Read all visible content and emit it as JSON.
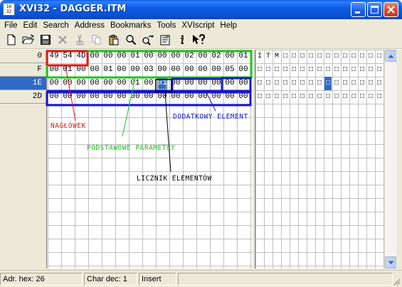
{
  "window": {
    "title": "XVI32 - DAGGER.ITM",
    "icon_text": "16 32",
    "buttons": [
      "minimize-icon",
      "maximize-icon",
      "close-icon"
    ]
  },
  "menu": [
    {
      "label": "File",
      "accel": "F"
    },
    {
      "label": "Edit",
      "accel": "E"
    },
    {
      "label": "Search",
      "accel": "S"
    },
    {
      "label": "Address",
      "accel": "A"
    },
    {
      "label": "Bookmarks",
      "accel": "B"
    },
    {
      "label": "Tools",
      "accel": "T"
    },
    {
      "label": "XVIscript",
      "accel": "X"
    },
    {
      "label": "Help",
      "accel": "H"
    }
  ],
  "toolbar": [
    "new-file-icon",
    "open-folder-icon",
    "save-disk-icon",
    "delete-x-icon",
    "cut-scissors-icon",
    "copy-icon",
    "paste-clipboard-icon",
    "find-magnifier-icon",
    "replace-icon",
    "properties-icon",
    "info-icon",
    "context-help-icon"
  ],
  "address_rows": [
    "0",
    "F",
    "1E",
    "2D"
  ],
  "selected_row": 2,
  "hex_rows": [
    [
      "49",
      "54",
      "4D",
      "00",
      "00",
      "00",
      "01",
      "00",
      "00",
      "00",
      "02",
      "00",
      "02",
      "00",
      "01"
    ],
    [
      "00",
      "01",
      "00",
      "00",
      "01",
      "00",
      "00",
      "03",
      "00",
      "00",
      "00",
      "00",
      "00",
      "05",
      "00"
    ],
    [
      "00",
      "00",
      "00",
      "00",
      "00",
      "00",
      "01",
      "00",
      "01",
      "00",
      "00",
      "00",
      "00",
      "00",
      "00"
    ],
    [
      "00",
      "00",
      "00",
      "00",
      "00",
      "00",
      "00",
      "00",
      "00",
      "00",
      "00",
      "00",
      "00",
      "00",
      "00"
    ]
  ],
  "text_rows": [
    [
      "I",
      "T",
      "M",
      "□",
      "□",
      "□",
      "□",
      "□",
      "□",
      "□",
      "□",
      "□",
      "□",
      "□",
      "□"
    ],
    [
      "□",
      "□",
      "□",
      "□",
      "□",
      "□",
      "□",
      "□",
      "□",
      "□",
      "□",
      "□",
      "□",
      "□",
      "□"
    ],
    [
      "□",
      "□",
      "□",
      "□",
      "□",
      "□",
      "□",
      "□",
      "□",
      "□",
      "□",
      "□",
      "□",
      "□",
      "□"
    ],
    [
      "□",
      "□",
      "□",
      "□",
      "□",
      "□",
      "□",
      "□",
      "□",
      "□",
      "□",
      "□",
      "□",
      "□",
      "□"
    ]
  ],
  "cursor": {
    "row": 2,
    "col": 8
  },
  "annotations": {
    "naglowek": {
      "text": "NAGŁÓWEK",
      "color": "#e01818"
    },
    "podstawowe": {
      "text": "PODSTAWOWE PARAMETRY",
      "color": "#18c818"
    },
    "licznik": {
      "text": "LICZNIK ELEMENTÓW",
      "color": "#000000"
    },
    "dodatkowy": {
      "text": "DODATKOWY ELEMENT",
      "color": "#1818c8"
    }
  },
  "status": {
    "adr_hex": "Adr. hex: 26",
    "char_dec": "Char dec: 1",
    "mode": "Insert"
  }
}
